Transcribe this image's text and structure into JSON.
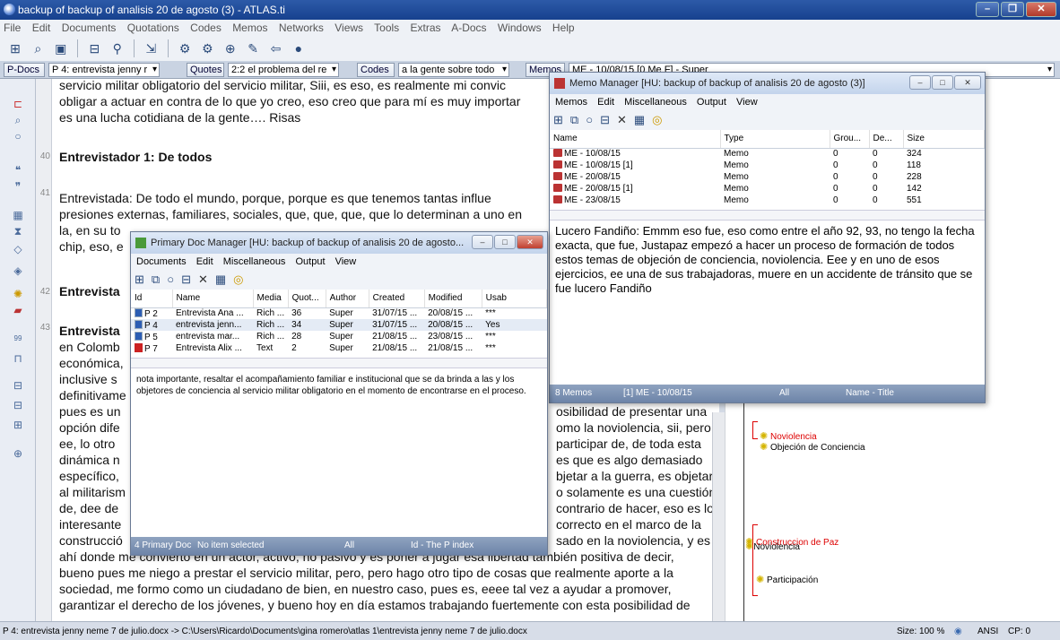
{
  "window": {
    "title": "backup of backup of analisis 20 de agosto (3) - ATLAS.ti",
    "menu": [
      "File",
      "Edit",
      "Documents",
      "Quotations",
      "Codes",
      "Memos",
      "Networks",
      "Views",
      "Tools",
      "Extras",
      "A-Docs",
      "Windows",
      "Help"
    ]
  },
  "docbar": {
    "pdocs_label": "P-Docs",
    "pdocs_value": "P 4: entrevista jenny r",
    "quotes_label": "Quotes",
    "quotes_value": "2:2 el problema del re",
    "codes_label": "Codes",
    "codes_value": "a la gente sobre todo",
    "memos_label": "Memos",
    "memos_value": "ME - 10/08/15 [0 Me F] - Super"
  },
  "document": {
    "line_numbers": [
      "40",
      "41",
      "42",
      "43"
    ],
    "lines": [
      "servicio militar obligatorio del servicio militar, Siii, es eso, es realmente mi convic",
      "obligar a actuar en contra de lo que yo creo, eso creo que para mí es muy importar",
      "es una lucha cotidiana de la gente…. Risas",
      "Entrevistador 1: De todos",
      "Entrevistada: De todo el mundo, porque, porque es que tenemos tantas influe",
      "presiones externas, familiares, sociales, que, que, que, que lo determinan a uno en",
      "la, en su to",
      "chip, eso, e",
      "Entrevista",
      "Entrevista",
      "en Colomb",
      "económica,",
      "inclusive s",
      "definitivame",
      "pues es un",
      "opción dife",
      "ee, lo otro",
      "dinámica n",
      "específico,",
      "al militarism",
      "de, dee de",
      "interesante",
      "construcció",
      "ahí donde me convierto en un actor, activo, no pasivo y es poner a jugar esa libertad también positiva de decir,",
      "bueno pues me niego a prestar el servicio militar, pero, pero hago otro tipo de cosas que realmente aporte a la",
      "sociedad, me formo como un ciudadano de bien, en nuestro caso, pues es, eeee tal vez a ayudar a promover,",
      "garantizar el derecho de los jóvenes, y bueno hoy en día estamos trabajando fuertemente con esta posibilidad de"
    ],
    "right_fragments": [
      "osibilidad de presentar una",
      "omo la noviolencia, sii, pero",
      "participar de, de toda esta",
      "es que es algo demasiado",
      "bjetar a la guerra, es objetar",
      "o solamente es una cuestión",
      "contrario de hacer, eso es lo",
      "correcto en el marco de la",
      "sado en la noviolencia, y es"
    ]
  },
  "margin_codes": {
    "noviolencia": "Noviolencia",
    "objecion": "Objeción de Conciencia",
    "construccion": "Construccion de Paz",
    "noviolencia2": "Noviolencia",
    "participacion": "Participación"
  },
  "memo_manager": {
    "title": "Memo Manager [HU: backup of backup of analisis 20 de agosto (3)]",
    "menu": [
      "Memos",
      "Edit",
      "Miscellaneous",
      "Output",
      "View"
    ],
    "columns": [
      "Name",
      "Type",
      "Grou...",
      "De...",
      "Size"
    ],
    "rows": [
      [
        "ME - 10/08/15",
        "Memo",
        "0",
        "0",
        "324"
      ],
      [
        "ME - 10/08/15 [1]",
        "Memo",
        "0",
        "0",
        "118"
      ],
      [
        "ME - 20/08/15",
        "Memo",
        "0",
        "0",
        "228"
      ],
      [
        "ME - 20/08/15 [1]",
        "Memo",
        "0",
        "0",
        "142"
      ],
      [
        "ME - 23/08/15",
        "Memo",
        "0",
        "0",
        "551"
      ]
    ],
    "text": "Lucero Fandiño: Emmm eso fue, eso como entre el año 92, 93, no tengo la fecha exacta, que fue, Justapaz empezó a hacer un proceso de formación de todos estos temas de objeción de conciencia, noviolencia. Eee y en uno de esos ejercicios, ee una de sus trabajadoras, muere en un accidente de tránsito que se fue lucero Fandiño",
    "status": [
      "8 Memos",
      "[1] ME - 10/08/15",
      "All",
      "Name - Title"
    ]
  },
  "pdoc_manager": {
    "title": "Primary Doc Manager [HU: backup of backup of analisis 20 de agosto...",
    "menu": [
      "Documents",
      "Edit",
      "Miscellaneous",
      "Output",
      "View"
    ],
    "columns": [
      "Id",
      "Name",
      "Media",
      "Quot...",
      "Author",
      "Created",
      "Modified",
      "Usab"
    ],
    "rows": [
      [
        "P 2",
        "Entrevista Ana ...",
        "Rich ...",
        "36",
        "Super",
        "31/07/15 ...",
        "20/08/15 ...",
        "***"
      ],
      [
        "P 4",
        "entrevista jenn...",
        "Rich ...",
        "34",
        "Super",
        "31/07/15 ...",
        "20/08/15 ...",
        "Yes"
      ],
      [
        "P 5",
        "entrevista mar...",
        "Rich ...",
        "28",
        "Super",
        "21/08/15 ...",
        "23/08/15 ...",
        "***"
      ],
      [
        "P 7",
        "Entrevista Alix ...",
        "Text",
        "2",
        "Super",
        "21/08/15 ...",
        "21/08/15 ...",
        "***"
      ]
    ],
    "comment": "nota importante, resaltar el acompañamiento familiar e institucional que se da brinda a las y los objetores de conciencia al servicio militar obligatorio en el momento de encontrarse en el proceso.",
    "status": [
      "4 Primary Doc",
      "No item selected",
      "All",
      "Id - The P index"
    ]
  },
  "statusbar": {
    "path": "P 4: entrevista jenny neme 7 de julio.docx -> C:\\Users\\Ricardo\\Documents\\gina romero\\atlas 1\\entrevista jenny neme 7 de julio.docx",
    "size": "Size: 100 %",
    "encoding": "ANSI",
    "codepage": "CP: 0"
  }
}
